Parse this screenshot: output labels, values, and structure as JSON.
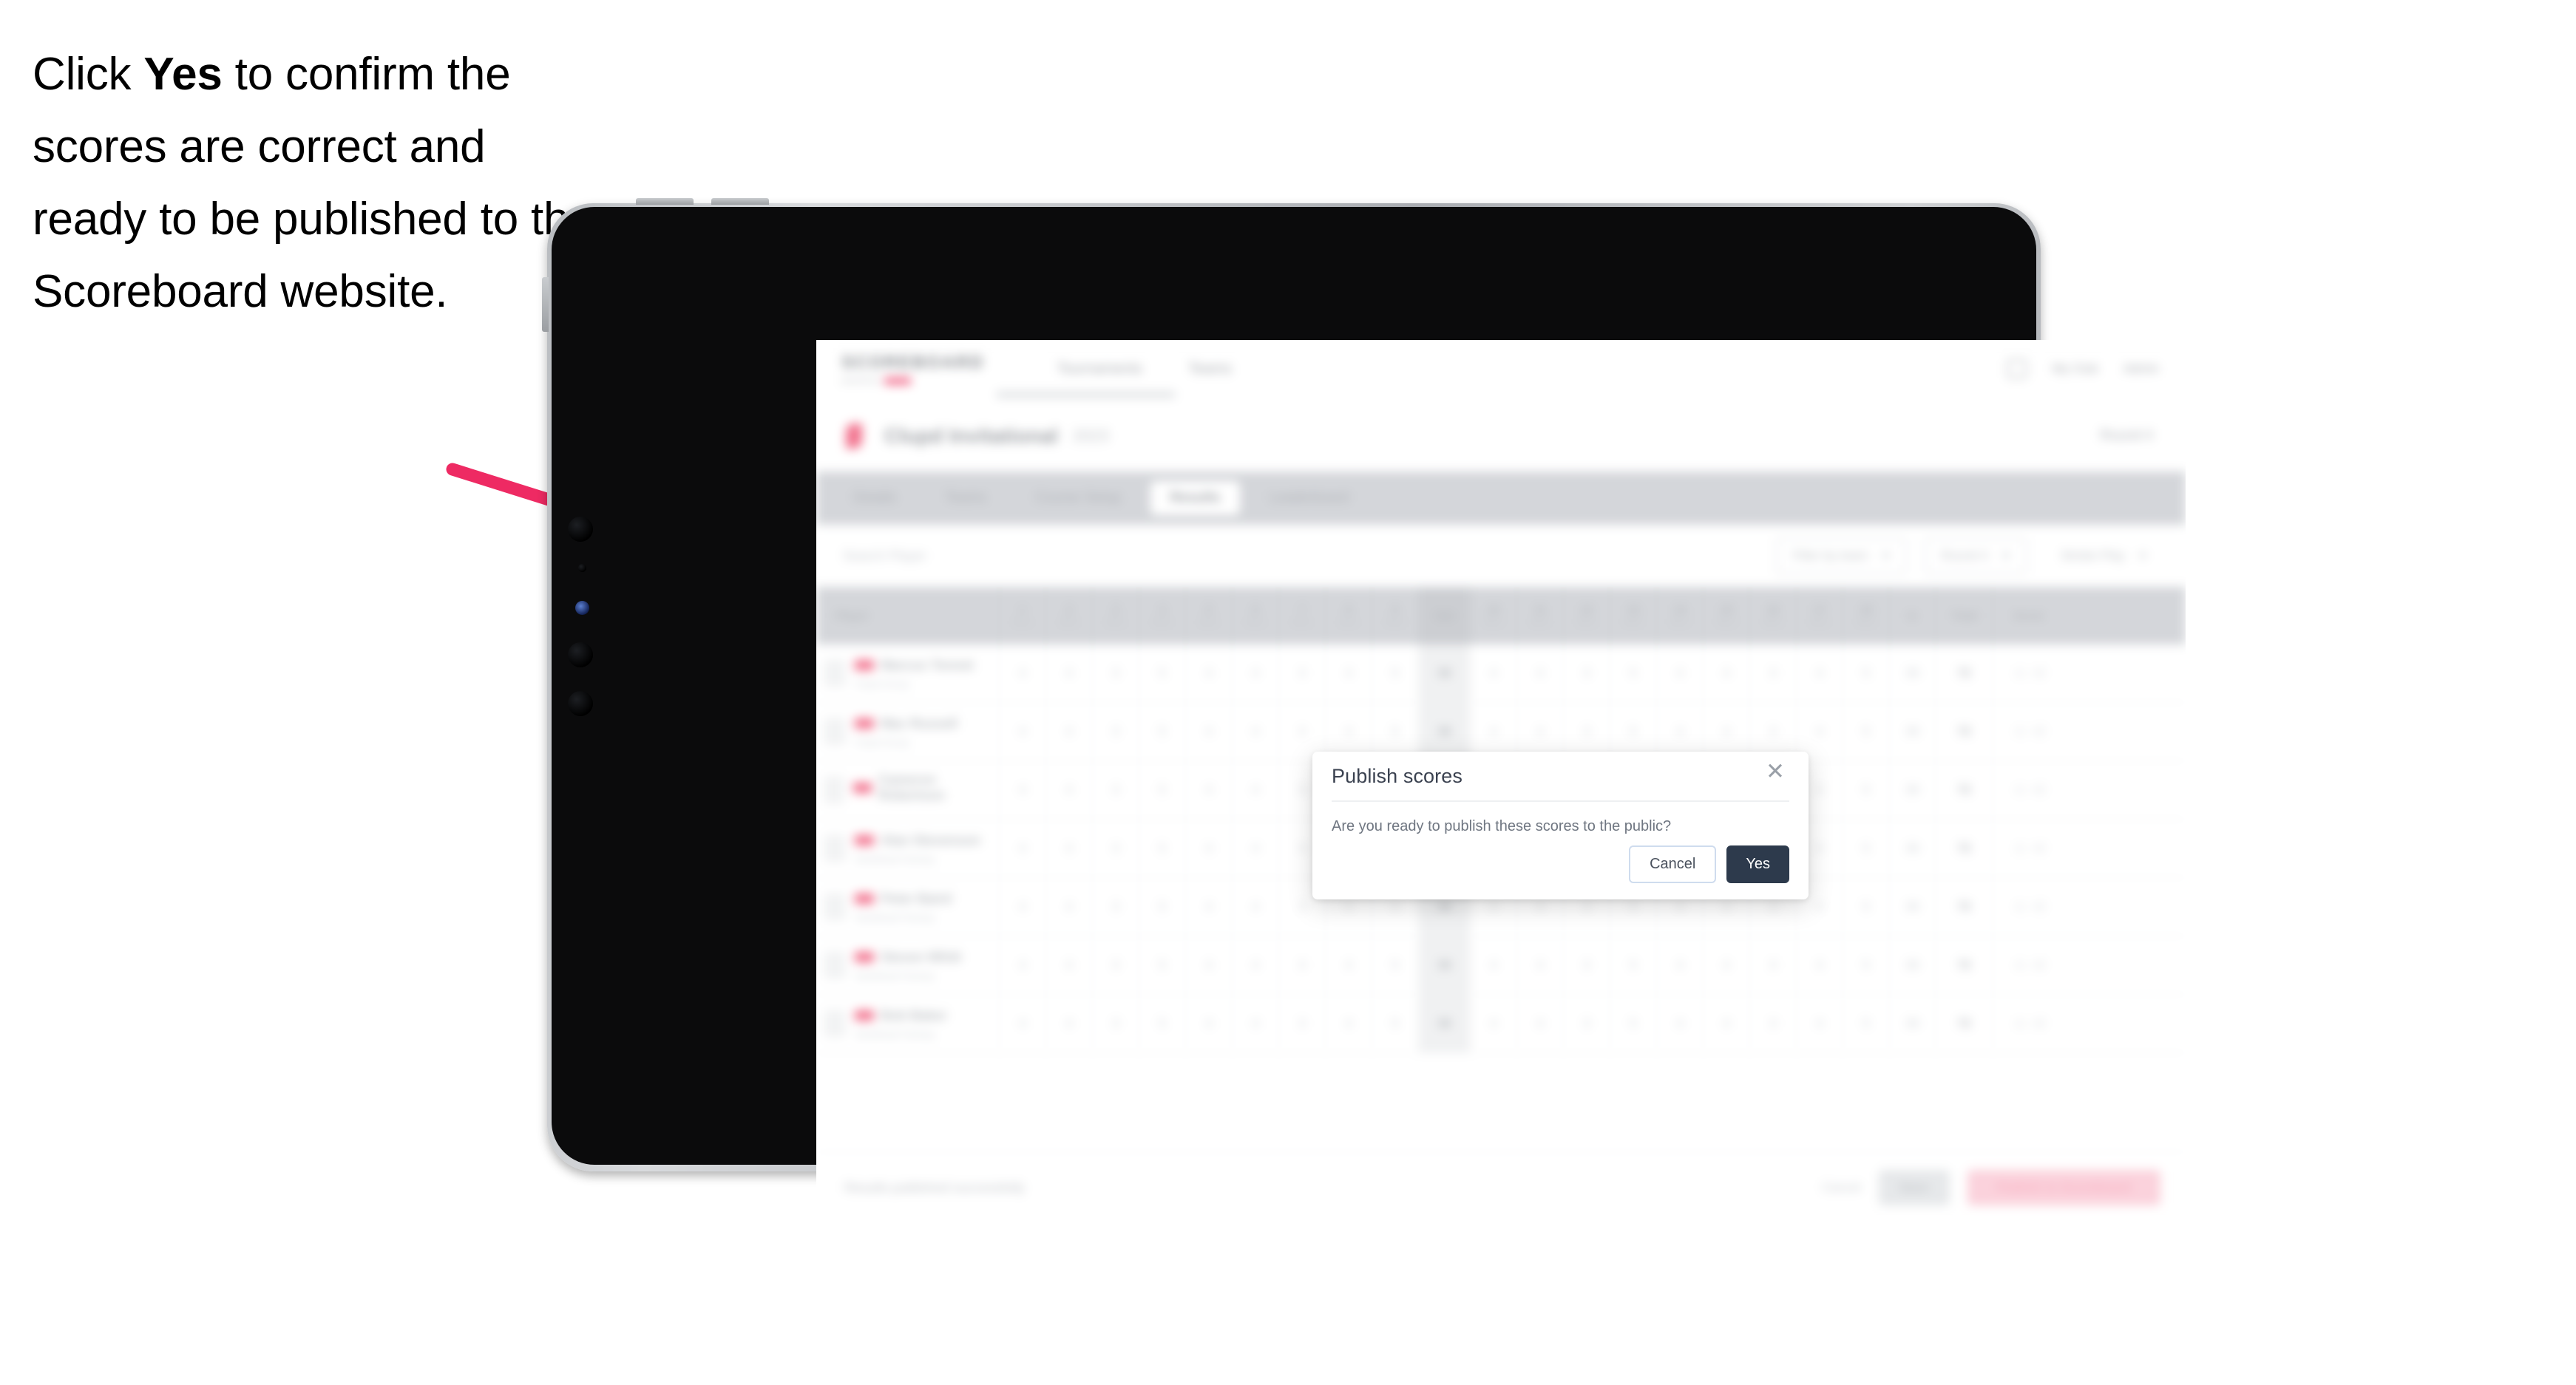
{
  "instruction": {
    "before": "Click ",
    "bold": "Yes",
    "after": " to confirm the scores are correct and ready to be published to the Scoreboard website."
  },
  "colors": {
    "arrow": "#EE2A63",
    "accent_pink": "#EF476F",
    "primary_dark": "#2D3A4C"
  },
  "app": {
    "nav": {
      "brand": "SCOREBOARD",
      "brand_sub": "powered by",
      "links": [
        "Tournaments",
        "Teams"
      ],
      "right_links": [
        "My Club",
        "Admin"
      ],
      "account_icon": "user-icon"
    },
    "event": {
      "name": "Clupd Invitational",
      "date": "2023",
      "round_label": "Round 4"
    },
    "tabs": [
      {
        "label": "Details",
        "active": false
      },
      {
        "label": "Teams",
        "active": false
      },
      {
        "label": "Course Setup",
        "active": false
      },
      {
        "label": "Results",
        "active": true
      },
      {
        "label": "Leaderboard",
        "active": false
      }
    ],
    "toolbar": {
      "search_placeholder": "Search Player",
      "filters": [
        {
          "label": "Filter by team",
          "caret": true
        },
        {
          "label": "Round 4",
          "caret": true
        },
        {
          "label": "Stroke Play",
          "caret": true
        }
      ]
    },
    "table": {
      "columns": {
        "player": "Player",
        "out": "Out",
        "in": "In",
        "total": "Total",
        "score": "Score"
      },
      "holes": [
        {
          "num": "1",
          "par": "Par 4"
        },
        {
          "num": "2",
          "par": "Par 4"
        },
        {
          "num": "3",
          "par": "Par 3"
        },
        {
          "num": "4",
          "par": "Par 5"
        },
        {
          "num": "5",
          "par": "Par 4"
        },
        {
          "num": "6",
          "par": "Par 4"
        },
        {
          "num": "7",
          "par": "Par 3"
        },
        {
          "num": "8",
          "par": "Par 4"
        },
        {
          "num": "9",
          "par": "Par 5"
        },
        {
          "num": "10",
          "par": "Par 4"
        },
        {
          "num": "11",
          "par": "Par 4"
        },
        {
          "num": "12",
          "par": "Par 3"
        },
        {
          "num": "13",
          "par": "Par 5"
        },
        {
          "num": "14",
          "par": "Par 4"
        },
        {
          "num": "15",
          "par": "Par 4"
        },
        {
          "num": "16",
          "par": "Par 3"
        },
        {
          "num": "17",
          "par": "Par 4"
        },
        {
          "num": "18",
          "par": "Par 5"
        }
      ],
      "rows": [
        {
          "rank": "1",
          "name": "Marcus Tennet",
          "club": "Clupd Group",
          "scores": [
            "4",
            "4",
            "3",
            "5",
            "4",
            "4",
            "3",
            "4",
            "5"
          ],
          "out": "36",
          "scores_in": [
            "4",
            "4",
            "3",
            "5",
            "4",
            "4",
            "3",
            "4",
            "5"
          ],
          "in": "36",
          "total": "72",
          "score": "-1",
          "to_par": "+2"
        },
        {
          "rank": "2",
          "name": "Mac Russell",
          "club": "Clupd Group",
          "scores": [
            "4",
            "4",
            "3",
            "5",
            "4",
            "4",
            "3",
            "4",
            "5"
          ],
          "out": "36",
          "scores_in": [
            "4",
            "4",
            "3",
            "5",
            "4",
            "4",
            "3",
            "4",
            "5"
          ],
          "in": "36",
          "total": "72",
          "score": "-1",
          "to_par": "+2"
        },
        {
          "rank": "3",
          "name": "Cameron Robertson",
          "club": "",
          "scores": [
            "4",
            "4",
            "3",
            "5",
            "4",
            "4",
            "3",
            "4",
            "5"
          ],
          "out": "36",
          "scores_in": [
            "4",
            "4",
            "3",
            "5",
            "4",
            "4",
            "3",
            "4",
            "5"
          ],
          "in": "36",
          "total": "72",
          "score": "-1",
          "to_par": "+2"
        },
        {
          "rank": "4",
          "name": "Alan Stevenson",
          "club": "Sandhead Fairway",
          "scores": [
            "4",
            "4",
            "3",
            "5",
            "4",
            "4",
            "3",
            "4",
            "5"
          ],
          "out": "36",
          "scores_in": [
            "4",
            "4",
            "3",
            "5",
            "4",
            "4",
            "3",
            "4",
            "5"
          ],
          "in": "36",
          "total": "72",
          "score": "-1",
          "to_par": "+2"
        },
        {
          "rank": "5",
          "name": "Peter Baird",
          "club": "Sandhead Fairway",
          "scores": [
            "4",
            "4",
            "3",
            "5",
            "4",
            "4",
            "3",
            "4",
            "5"
          ],
          "out": "36",
          "scores_in": [
            "4",
            "4",
            "3",
            "5",
            "4",
            "4",
            "3",
            "4",
            "5"
          ],
          "in": "36",
          "total": "72",
          "score": "-1",
          "to_par": "+2"
        },
        {
          "rank": "6",
          "name": "Steven Whitt",
          "club": "Sandhead Fairway",
          "scores": [
            "4",
            "4",
            "3",
            "5",
            "4",
            "4",
            "3",
            "4",
            "5"
          ],
          "out": "36",
          "scores_in": [
            "4",
            "4",
            "3",
            "5",
            "4",
            "4",
            "3",
            "4",
            "5"
          ],
          "in": "36",
          "total": "72",
          "score": "-1",
          "to_par": "+2"
        },
        {
          "rank": "7",
          "name": "Bob Baker",
          "club": "Sandhead Fairway",
          "scores": [
            "4",
            "4",
            "3",
            "5",
            "4",
            "4",
            "3",
            "4",
            "5"
          ],
          "out": "36",
          "scores_in": [
            "4",
            "4",
            "3",
            "5",
            "4",
            "4",
            "3",
            "4",
            "5"
          ],
          "in": "36",
          "total": "72",
          "score": "-1",
          "to_par": "+2"
        }
      ]
    },
    "footer": {
      "message": "Results published successfully",
      "cancel_link": "Cancel",
      "save_button": "Save",
      "publish_button": "Publish to Scoreboard"
    }
  },
  "modal": {
    "title": "Publish scores",
    "body": "Are you ready to publish these scores to the public?",
    "cancel_label": "Cancel",
    "confirm_label": "Yes",
    "close_icon": "close-icon"
  }
}
